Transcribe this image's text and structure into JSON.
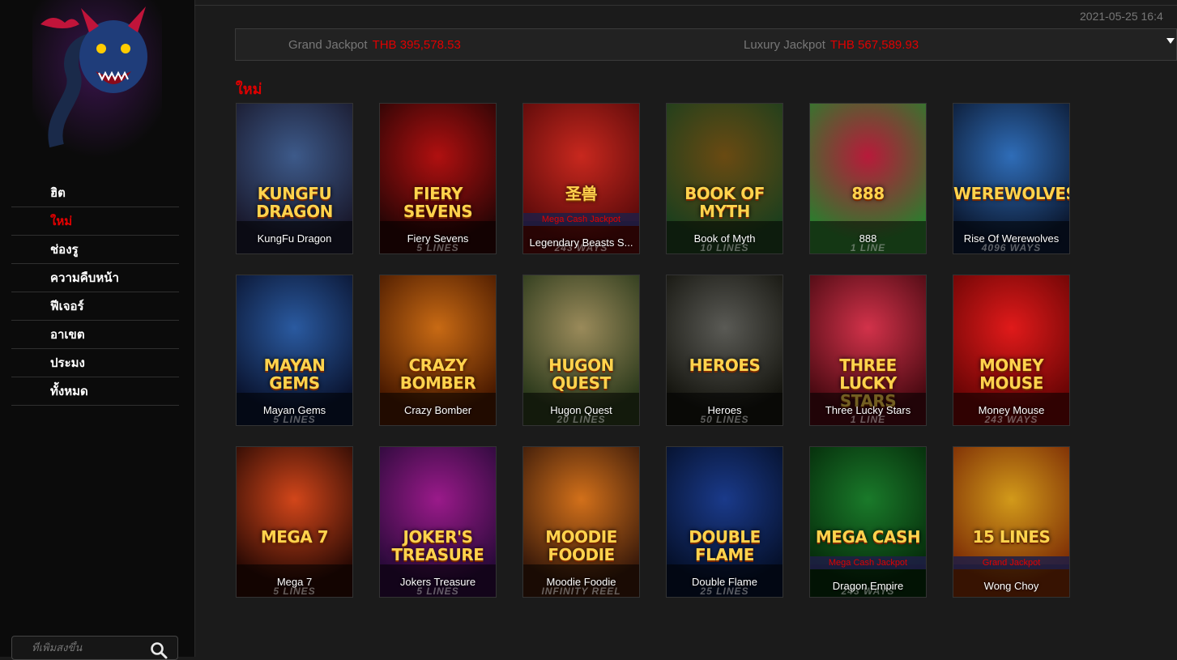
{
  "sidebar": {
    "nav": [
      {
        "label": "ฮิต",
        "active": false
      },
      {
        "label": "ใหม่",
        "active": true
      },
      {
        "label": "ช่องรู",
        "active": false
      },
      {
        "label": "ความคืบหน้า",
        "active": false
      },
      {
        "label": "ฟีเจอร์",
        "active": false
      },
      {
        "label": "อาเขต",
        "active": false
      },
      {
        "label": "ประมง",
        "active": false
      },
      {
        "label": "ทั้งหมด",
        "active": false
      }
    ],
    "search": {
      "placeholder": "ที่เพิ่มสงขึ้น",
      "icon": "search-icon"
    }
  },
  "header": {
    "datetime": "2021-05-25 16:4",
    "jackpots": [
      {
        "label": "Grand Jackpot",
        "value": "THB 395,578.53"
      },
      {
        "label": "Luxury Jackpot",
        "value": "THB 567,589.93"
      }
    ]
  },
  "section": {
    "title": "ใหม่"
  },
  "colors": {
    "accent": "#e60000",
    "background": "#1b1b1b",
    "sidebar": "#0b0b0b"
  },
  "games": [
    {
      "name": "KungFu Dragon",
      "art": "KUNGFU DRAGON",
      "lines": "",
      "tag": "",
      "c1": "#3d5a8a",
      "c2": "#1a1a2e"
    },
    {
      "name": "Fiery Sevens",
      "art": "FIERY SEVENS",
      "lines": "5 LINES",
      "tag": "",
      "c1": "#b01010",
      "c2": "#2a0505"
    },
    {
      "name": "Legendary Beasts S...",
      "art": "圣兽",
      "lines": "243 WAYS",
      "tag": "Mega Cash Jackpot",
      "c1": "#c8281e",
      "c2": "#5a0a0a"
    },
    {
      "name": "Book of Myth",
      "art": "BOOK OF MYTH",
      "lines": "10 LINES",
      "tag": "",
      "c1": "#6a4a12",
      "c2": "#1d3f1d"
    },
    {
      "name": "888",
      "art": "888",
      "lines": "1 LINE",
      "tag": "",
      "c1": "#b81a3a",
      "c2": "#2e7a2e"
    },
    {
      "name": "Rise Of Werewolves",
      "art": "WEREWOLVES",
      "lines": "4096 WAYS",
      "tag": "",
      "c1": "#2f6db8",
      "c2": "#0c1a33"
    },
    {
      "name": "Mayan Gems",
      "art": "MAYAN GEMS",
      "lines": "5 LINES",
      "tag": "",
      "c1": "#2a5aa0",
      "c2": "#0a1430"
    },
    {
      "name": "Crazy Bomber",
      "art": "CRAZY BOMBER",
      "lines": "",
      "tag": "",
      "c1": "#c86a14",
      "c2": "#4a1a00"
    },
    {
      "name": "Hugon Quest",
      "art": "HUGON QUEST",
      "lines": "20 LINES",
      "tag": "",
      "c1": "#9a8a5a",
      "c2": "#2c3a1c"
    },
    {
      "name": "Heroes",
      "art": "HEROES",
      "lines": "50 LINES",
      "tag": "",
      "c1": "#5a5a55",
      "c2": "#15150f"
    },
    {
      "name": "Three Lucky Stars",
      "art": "THREE LUCKY STARS",
      "lines": "1 LINE",
      "tag": "",
      "c1": "#d2324a",
      "c2": "#4a0a12"
    },
    {
      "name": "Money Mouse",
      "art": "MONEY MOUSE",
      "lines": "243 WAYS",
      "tag": "",
      "c1": "#e01a1a",
      "c2": "#6a0505"
    },
    {
      "name": "Mega 7",
      "art": "MEGA 7",
      "lines": "5 LINES",
      "tag": "",
      "c1": "#d2461a",
      "c2": "#2a0a04"
    },
    {
      "name": "Jokers Treasure",
      "art": "JOKER'S TREASURE",
      "lines": "5 LINES",
      "tag": "",
      "c1": "#9a1a8a",
      "c2": "#2a0a3a"
    },
    {
      "name": "Moodie Foodie",
      "art": "MOODIE FOODIE",
      "lines": "INFINITY REEL",
      "tag": "",
      "c1": "#d2701a",
      "c2": "#3a1a0a"
    },
    {
      "name": "Double Flame",
      "art": "DOUBLE FLAME",
      "lines": "25 LINES",
      "tag": "",
      "c1": "#1a3a8a",
      "c2": "#05102a"
    },
    {
      "name": "Dragon Empire",
      "art": "MEGA CASH",
      "lines": "243 WAYS",
      "tag": "Mega Cash Jackpot",
      "c1": "#1a7a2a",
      "c2": "#052a0a"
    },
    {
      "name": "Wong Choy",
      "art": "15 LINES",
      "lines": "",
      "tag": "Grand Jackpot",
      "c1": "#d29a1a",
      "c2": "#7a2a05"
    }
  ]
}
